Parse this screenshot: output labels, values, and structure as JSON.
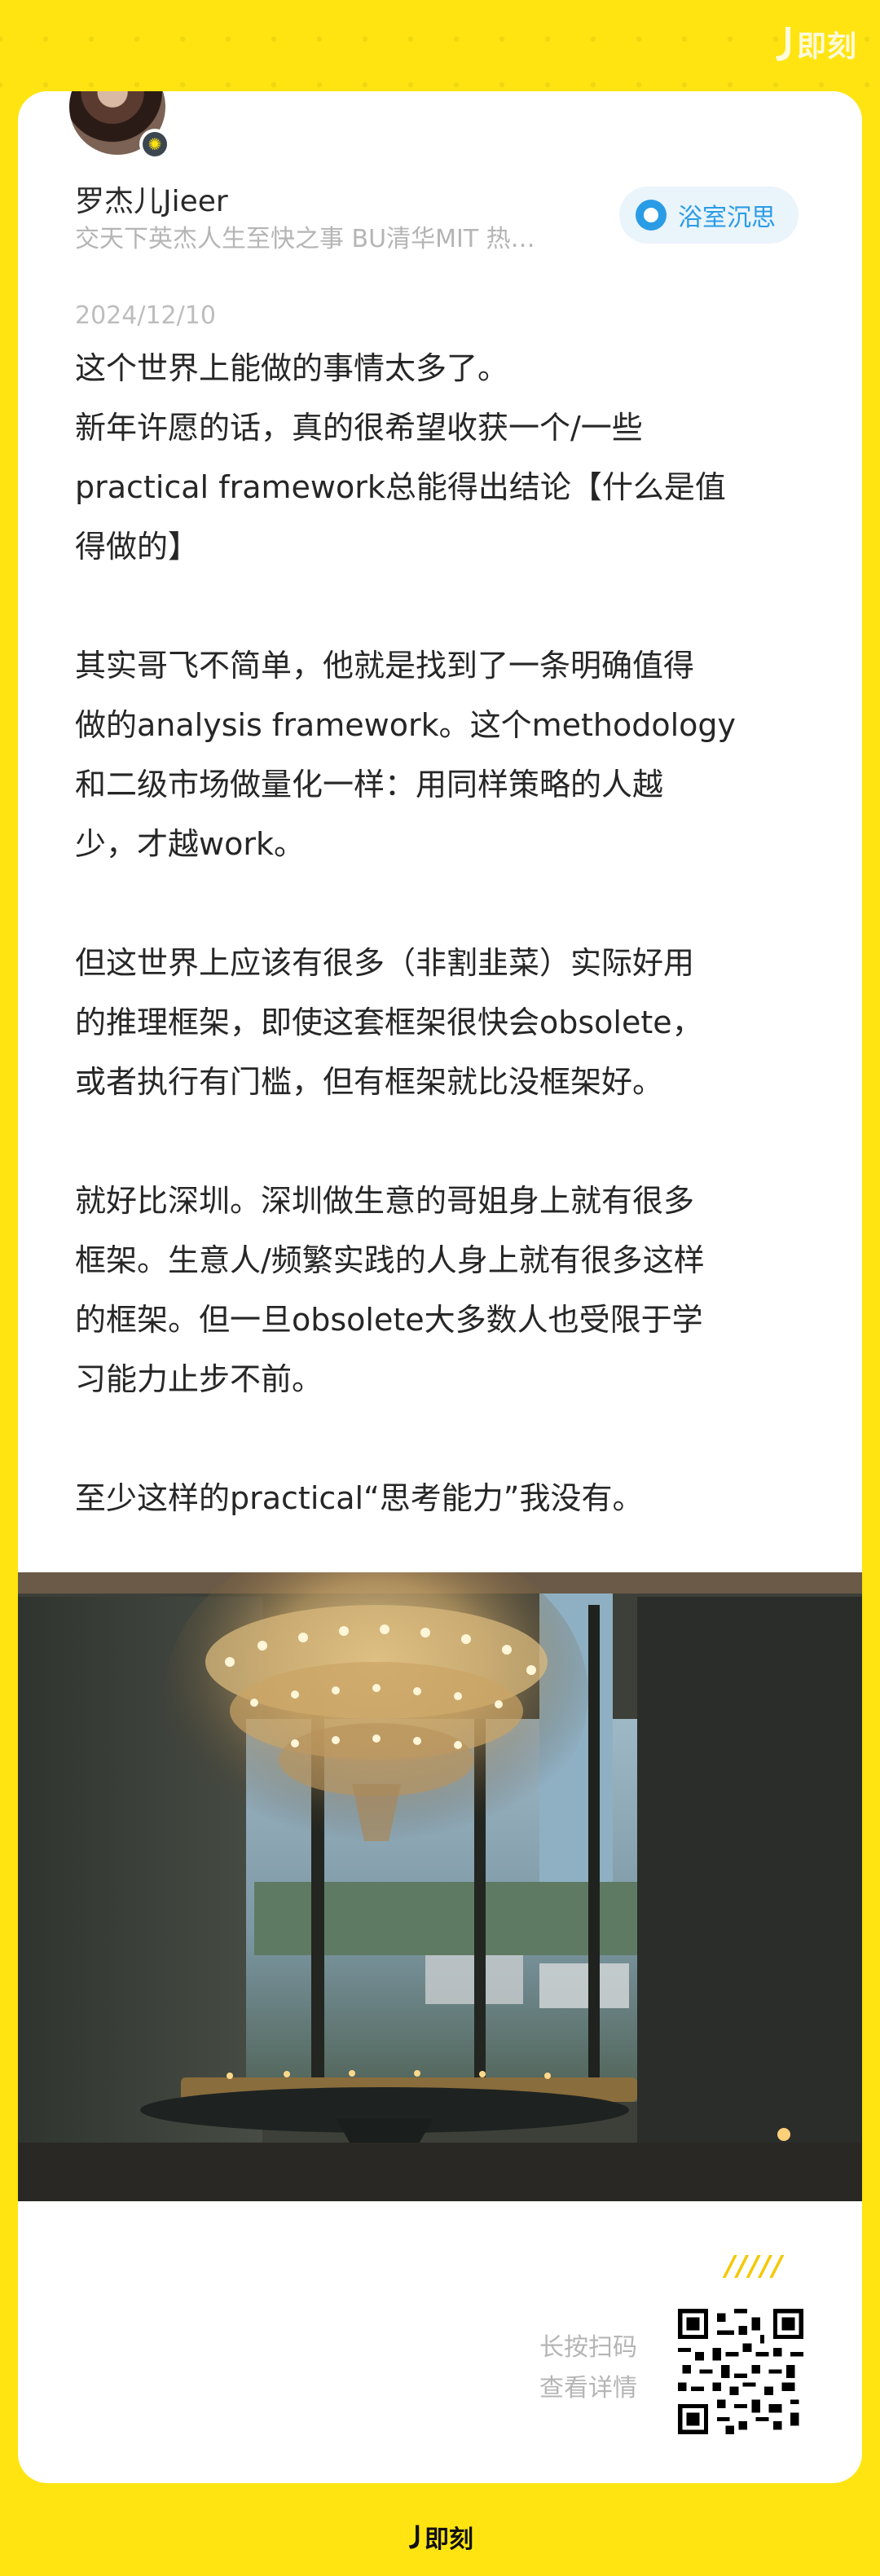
{
  "brand": {
    "name": "即刻"
  },
  "author": {
    "name": "罗杰儿Jieer",
    "bio": "交天下英杰人生至快之事 BU清华MIT 热…"
  },
  "topic": {
    "label": "浴室沉思"
  },
  "post": {
    "date": "2024/12/10",
    "paragraphs": [
      [
        "这个世界上能做的事情太多了。",
        "新年许愿的话，真的很希望收获一个/一些",
        "practical framework总能得出结论【什么是值",
        "得做的】"
      ],
      [
        "其实哥飞不简单，他就是找到了一条明确值得",
        "做的analysis framework。这个methodology",
        "和二级市场做量化一样：用同样策略的人越",
        "少，才越work。"
      ],
      [
        "但这世界上应该有很多（非割韭菜）实际好用",
        "的推理框架，即使这套框架很快会obsolete，",
        "或者执行有门槛，但有框架就比没框架好。"
      ],
      [
        "就好比深圳。深圳做生意的哥姐身上就有很多",
        "框架。生意人/频繁实践的人身上就有很多这样",
        "的框架。但一旦obsolete大多数人也受限于学",
        "习能力止步不前。"
      ],
      [
        "至少这样的practical“思考能力”我没有。"
      ]
    ]
  },
  "footer": {
    "stripes": "/////",
    "scan_line1": "长按扫码",
    "scan_line2": "查看详情"
  },
  "colors": {
    "background": "#FFE411",
    "topic_accent": "#2A9CE6"
  }
}
